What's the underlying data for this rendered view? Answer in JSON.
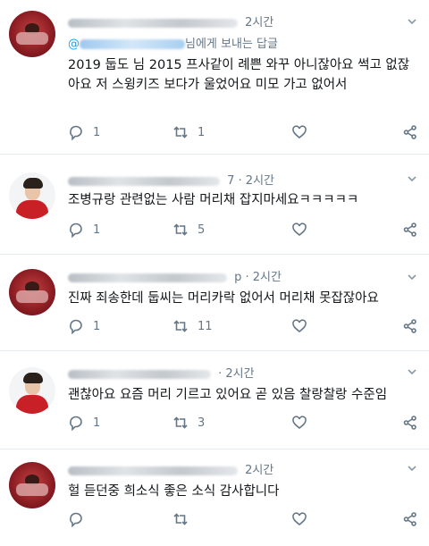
{
  "tweets": [
    {
      "avatar": "red-shirt-avatar",
      "header_tail": "2시간",
      "replying_suffix": "님에게 보내는 답글",
      "text": "2019 둡도 님 2015 프사같이 례쁜 와꾸 아니잖아요 썩고 없잖아요 저 스윙키즈 보다가 울었어요 미모 가고 없어서",
      "replies": "1",
      "retweets": "1",
      "likes": ""
    },
    {
      "avatar": "red-scarf-avatar",
      "header_tail": "7 · 2시간",
      "text": "조병규랑 관련없는 사람 머리채 잡지마세요ㅋㅋㅋㅋㅋ",
      "replies": "1",
      "retweets": "5",
      "likes": ""
    },
    {
      "avatar": "red-shirt-avatar",
      "header_tail": "p · 2시간",
      "text": "진짜 죄송한데 둡씨는 머리카락 없어서 머리채 못잡잖아요",
      "replies": "1",
      "retweets": "11",
      "likes": ""
    },
    {
      "avatar": "red-scarf-avatar",
      "header_tail": "· 2시간",
      "text": "괜찮아요 요즘 머리 기르고 있어요 곧 있음 찰랑찰랑 수준임",
      "replies": "1",
      "retweets": "3",
      "likes": ""
    },
    {
      "avatar": "red-shirt-avatar",
      "header_tail": "2시간",
      "text": "헐 듣던중 희소식 좋은 소식 감사합니다",
      "replies": "",
      "retweets": "",
      "likes": ""
    }
  ],
  "icons": {
    "reply": "reply-icon",
    "retweet": "retweet-icon",
    "like": "heart-icon",
    "share": "share-icon",
    "menu": "chevron-down-icon"
  },
  "colors": {
    "meta": "#657786",
    "link": "#1da1f2",
    "divider": "#e6ecf0"
  }
}
